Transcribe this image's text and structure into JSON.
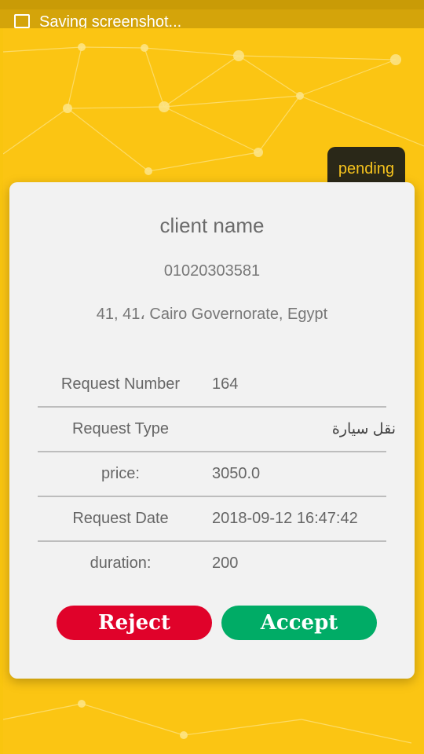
{
  "notification": {
    "text": "Saving screenshot..."
  },
  "status": {
    "label": "pending"
  },
  "client": {
    "name": "client name",
    "phone": "01020303581",
    "address": "41, 41، Cairo Governorate, Egypt"
  },
  "details": [
    {
      "label": "Request Number",
      "value": "164"
    },
    {
      "label": "Request Type",
      "value": "نقل سيارة"
    },
    {
      "label": "price:",
      "value": "3050.0"
    },
    {
      "label": "Request Date",
      "value": "2018-09-12 16:47:42"
    },
    {
      "label": "duration:",
      "value": "200"
    }
  ],
  "actions": {
    "reject_label": "Reject",
    "accept_label": "Accept"
  },
  "colors": {
    "background": "#fbc513",
    "reject": "#e0022a",
    "accept": "#00ac66",
    "badge": "#2a2818"
  }
}
